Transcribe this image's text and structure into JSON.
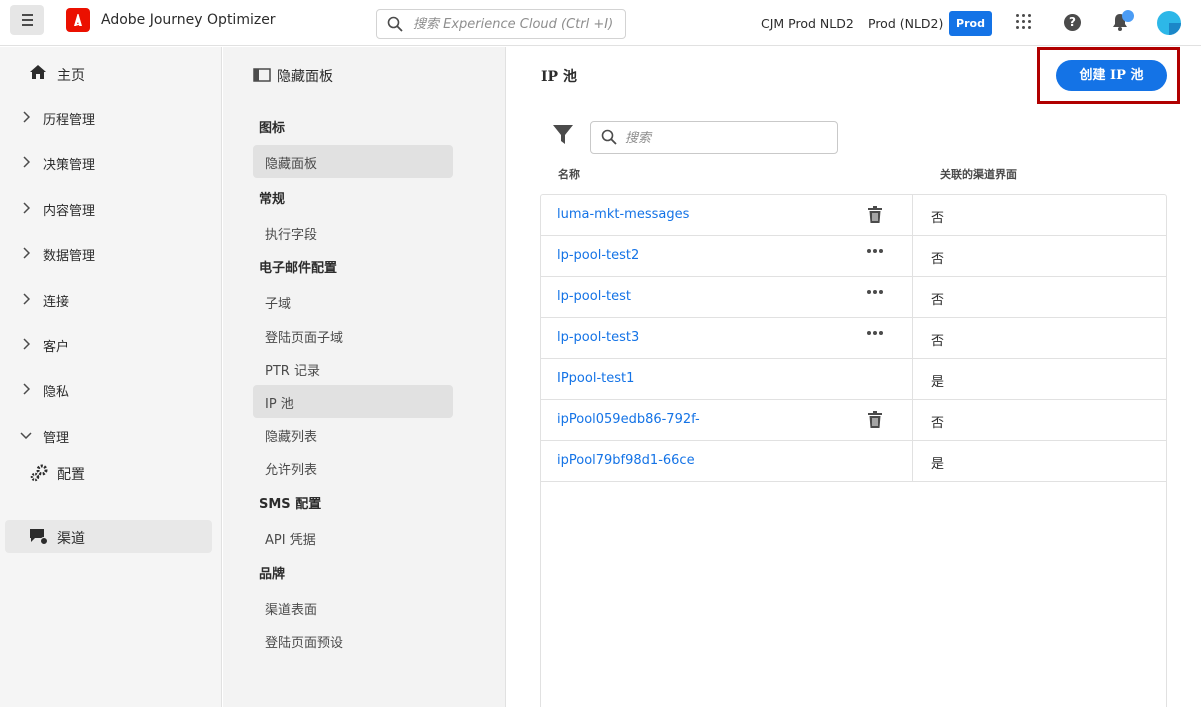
{
  "app": {
    "title": "Adobe Journey Optimizer"
  },
  "header": {
    "search_placeholder": "搜索 Experience Cloud (Ctrl +I)",
    "org": "CJM Prod NLD2",
    "sandbox": "Prod (NLD2)",
    "env_badge": "Prod",
    "accent": "#1473e6"
  },
  "leftnav": {
    "home": "主页",
    "items": [
      {
        "label": "历程管理"
      },
      {
        "label": "决策管理"
      },
      {
        "label": "内容管理"
      },
      {
        "label": "数据管理"
      },
      {
        "label": "连接"
      },
      {
        "label": "客户"
      },
      {
        "label": "隐私"
      },
      {
        "label": "管理"
      }
    ],
    "config": "配置",
    "channel": "渠道"
  },
  "midpanel": {
    "header": "隐藏面板",
    "sections": {
      "icons": "图标",
      "general": "常规",
      "email": "电子邮件配置",
      "sms": "SMS 配置",
      "brand": "品牌"
    },
    "items": {
      "hide_panel": "隐藏面板",
      "exec_fields": "执行字段",
      "subdomain": "子域",
      "landing_subdomain": "登陆页面子域",
      "ptr": "PTR 记录",
      "ip_pool": "IP 池",
      "suppression": "隐藏列表",
      "allow": "允许列表",
      "api_creds": "API 凭据",
      "channel_surface": "渠道表面",
      "landing_preset": "登陆页面预设"
    }
  },
  "main": {
    "title": "IP 池",
    "create_button": "创建 IP 池",
    "search_placeholder": "搜索",
    "columns": {
      "name": "名称",
      "associated": "关联的渠道界面"
    },
    "rows": [
      {
        "name": "luma-mkt-messages",
        "associated": "否",
        "action": "trash"
      },
      {
        "name": "lp-pool-test2",
        "associated": "否",
        "action": "more"
      },
      {
        "name": "lp-pool-test",
        "associated": "否",
        "action": "more"
      },
      {
        "name": "lp-pool-test3",
        "associated": "否",
        "action": "more"
      },
      {
        "name": "IPpool-test1",
        "associated": "是",
        "action": ""
      },
      {
        "name": "ipPool059edb86-792f-",
        "associated": "否",
        "action": "trash"
      },
      {
        "name": "ipPool79bf98d1-66ce",
        "associated": "是",
        "action": ""
      }
    ]
  }
}
